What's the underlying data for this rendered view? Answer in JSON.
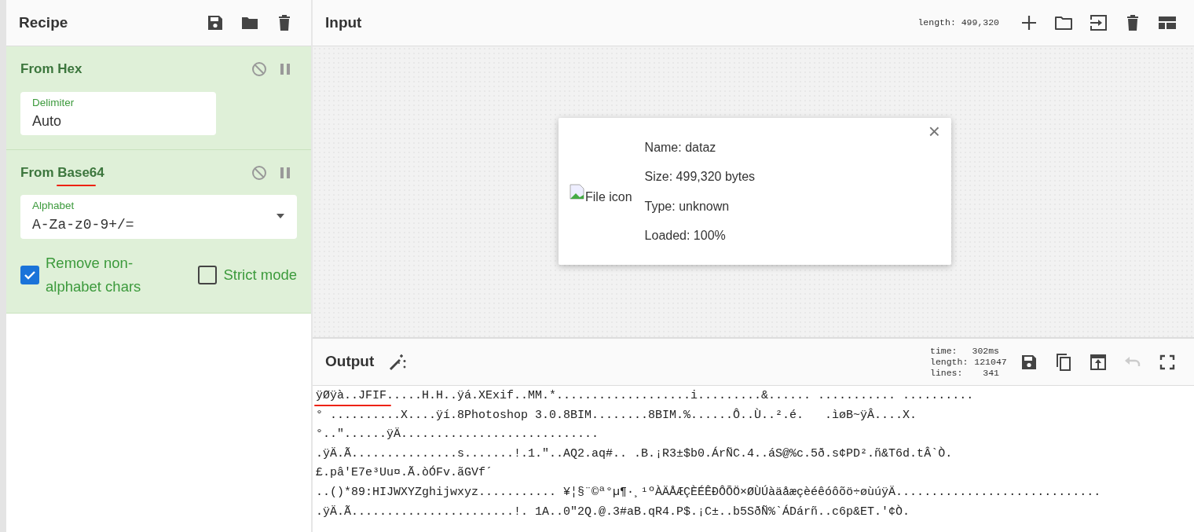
{
  "recipe": {
    "title": "Recipe",
    "buttons": [
      {
        "kind": "save"
      },
      {
        "kind": "folder"
      },
      {
        "kind": "trash"
      }
    ],
    "operations": [
      {
        "name": "From Hex",
        "fields": [
          {
            "kind": "text",
            "label": "Delimiter",
            "value": "Auto"
          }
        ]
      },
      {
        "name": "From Base64",
        "fields": [
          {
            "kind": "select",
            "label": "Alphabet",
            "value": "A-Za-z0-9+/="
          }
        ],
        "checkboxes": [
          {
            "label": "Remove non-alphabet chars",
            "checked": true
          },
          {
            "label": "Strict mode",
            "checked": false
          }
        ]
      }
    ]
  },
  "input": {
    "title": "Input",
    "info": "length: 499,320",
    "buttons": [
      {
        "kind": "plus"
      },
      {
        "kind": "folder-outline"
      },
      {
        "kind": "import"
      },
      {
        "kind": "trash"
      },
      {
        "kind": "layout"
      }
    ],
    "file_card": {
      "icon_alt": "File icon",
      "lines": [
        "Name: dataz",
        "Size: 499,320 bytes",
        "Type: unknown",
        "Loaded: 100%"
      ],
      "close": "×"
    }
  },
  "output": {
    "title": "Output",
    "stats": [
      {
        "label": "time:",
        "value": "302ms"
      },
      {
        "label": "length:",
        "value": "121047"
      },
      {
        "label": "lines:",
        "value": "341"
      }
    ],
    "buttons": [
      {
        "kind": "save",
        "disabled": false
      },
      {
        "kind": "copy",
        "disabled": false
      },
      {
        "kind": "export",
        "disabled": false
      },
      {
        "kind": "undo",
        "disabled": true
      },
      {
        "kind": "fullscreen",
        "disabled": false
      }
    ],
    "lines": [
      "ÿØÿà..JFIF.....H.H..ÿá.XExif..MM.*...................i.........&...... ........... ..........",
      "° ..........X....ÿí.8Photoshop 3.0.8BIM........8BIM.%......Ô..Ù..².é.   .ìøB~ÿÂ....X.",
      "°..\"......ÿÄ............................",
      ".ÿÄ.Ã...............s.......!.1.\"..AQ2.aq#.. .B.¡R3±$b0.ÁrÑC.4..áS@%c.5ð.s¢PD².ñ&T6d.tÂ`Ò.",
      "£.pâ'E7e³Uu¤.Ã.òÓFv.ãGVf´",
      "..()*89:HIJWXYZghijwxyz........... ¥¦§¨©ª°µ¶·¸¹ºÀÄÅÆÇÈÉÊÐÔÕÖ×ØÙÚàäåæçèéêóôõö÷øùúÿÄ.............................",
      ".ÿÄ.Ã.......................!. 1A..0\"2Q.@.3#aB.qR4.P$.¡C±..b5SðÑ%`ÁDárñ..c6p&ET.'¢Ò."
    ]
  }
}
